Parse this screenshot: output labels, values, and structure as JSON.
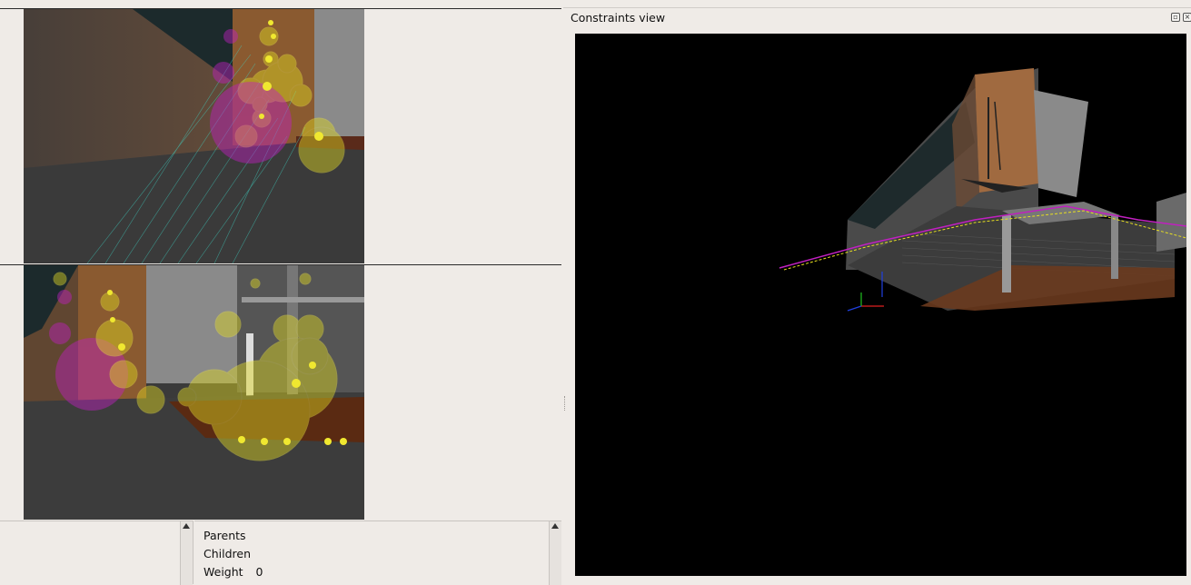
{
  "constraints_view": {
    "title": "Constraints view",
    "float_button_icon": "float-icon",
    "close_button_icon": "close-icon"
  },
  "link_info": {
    "parents_label": "Parents",
    "children_label": "Children",
    "weight_label": "Weight",
    "weight_value": "0"
  },
  "colors": {
    "window_bg": "#efebe7",
    "canvas_bg": "#000000",
    "feature_yellow": "#e8e020",
    "feature_magenta": "#d020d0",
    "match_line": "#3fd8c8"
  }
}
